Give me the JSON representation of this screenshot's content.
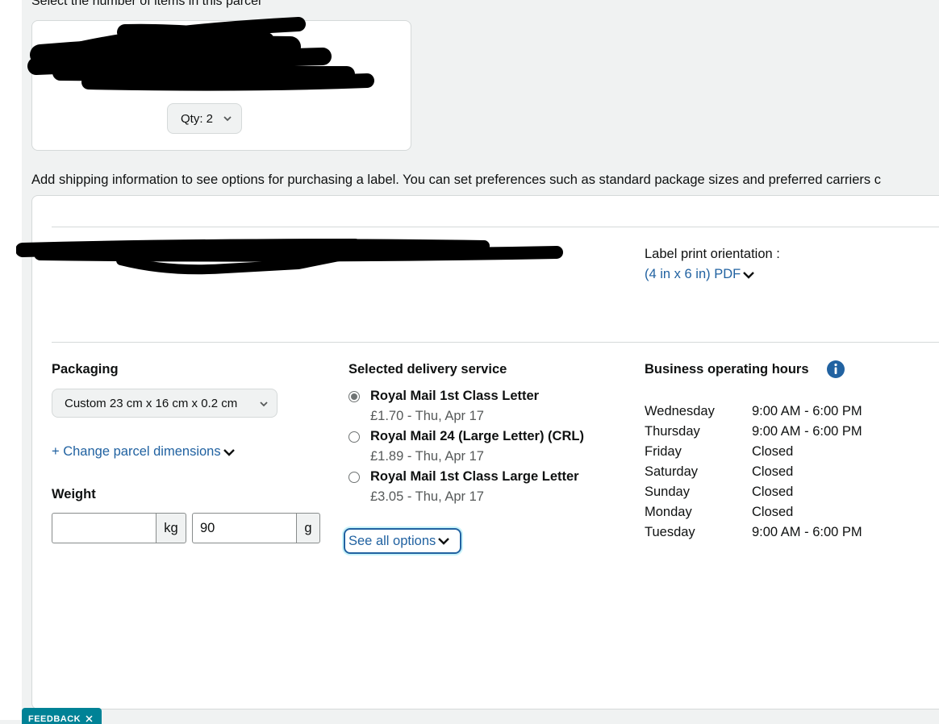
{
  "parcel": {
    "select_items_label": "Select the number of items in this parcel",
    "qty_label": "Qty: 2"
  },
  "info_text": "Add shipping information to see options for purchasing a label. You can set preferences such as standard package sizes and preferred carriers c",
  "label_print": {
    "title": "Label print orientation :",
    "value": "(4 in x 6 in) PDF"
  },
  "packaging": {
    "title": "Packaging",
    "selected": "Custom 23 cm x 16 cm x 0.2 cm",
    "change_link": "+ Change parcel dimensions"
  },
  "weight": {
    "title": "Weight",
    "kg_value": "",
    "kg_unit": "kg",
    "g_value": "90",
    "g_unit": "g"
  },
  "delivery": {
    "title": "Selected delivery service",
    "options": [
      {
        "name": "Royal Mail 1st Class Letter",
        "price": "£1.70 - Thu, Apr 17",
        "selected": true
      },
      {
        "name": "Royal Mail 24 (Large Letter) (CRL)",
        "price": "£1.89 - Thu, Apr 17",
        "selected": false
      },
      {
        "name": "Royal Mail 1st Class Large Letter",
        "price": "£3.05 - Thu, Apr 17",
        "selected": false
      }
    ],
    "see_all": "See all options"
  },
  "hours": {
    "title": "Business operating hours",
    "rows": [
      {
        "day": "Wednesday",
        "time": "9:00 AM - 6:00 PM"
      },
      {
        "day": "Thursday",
        "time": "9:00 AM - 6:00 PM"
      },
      {
        "day": "Friday",
        "time": "Closed"
      },
      {
        "day": "Saturday",
        "time": "Closed"
      },
      {
        "day": "Sunday",
        "time": "Closed"
      },
      {
        "day": "Monday",
        "time": "Closed"
      },
      {
        "day": "Tuesday",
        "time": "9:00 AM - 6:00 PM"
      }
    ]
  },
  "feedback_label": "FEEDBACK",
  "colors": {
    "link": "#2162a1",
    "info_icon": "#2162a1",
    "feedback_tab": "#008296",
    "redaction": "#000000"
  }
}
